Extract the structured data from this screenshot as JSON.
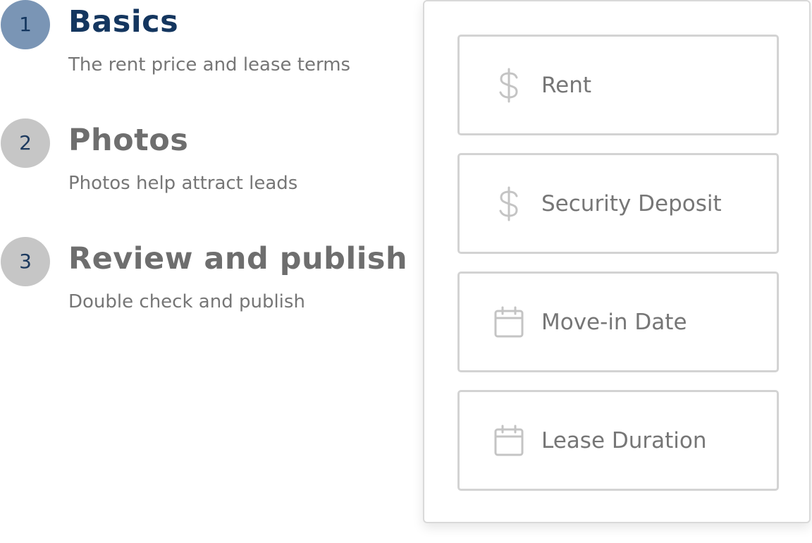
{
  "steps": [
    {
      "number": "1",
      "title": "Basics",
      "description": "The rent price and lease terms",
      "active": true
    },
    {
      "number": "2",
      "title": "Photos",
      "description": "Photos help attract leads",
      "active": false
    },
    {
      "number": "3",
      "title": "Review and publish",
      "description": "Double check and publish",
      "active": false
    }
  ],
  "form": {
    "fields": [
      {
        "icon": "dollar-icon",
        "value": "",
        "placeholder": "Rent"
      },
      {
        "icon": "dollar-icon",
        "value": "",
        "placeholder": "Security Deposit"
      },
      {
        "icon": "calendar-icon",
        "value": "",
        "placeholder": "Move-in Date"
      },
      {
        "icon": "calendar-icon",
        "value": "",
        "placeholder": "Lease Duration"
      }
    ]
  },
  "colors": {
    "active_step_circle": "#7a95b5",
    "active_step_text": "#14365f",
    "inactive_step_circle": "#c6c6c6",
    "inactive_step_title": "#6e6e6e",
    "field_border": "#d3d3d3",
    "icon": "#c4c4c4"
  }
}
